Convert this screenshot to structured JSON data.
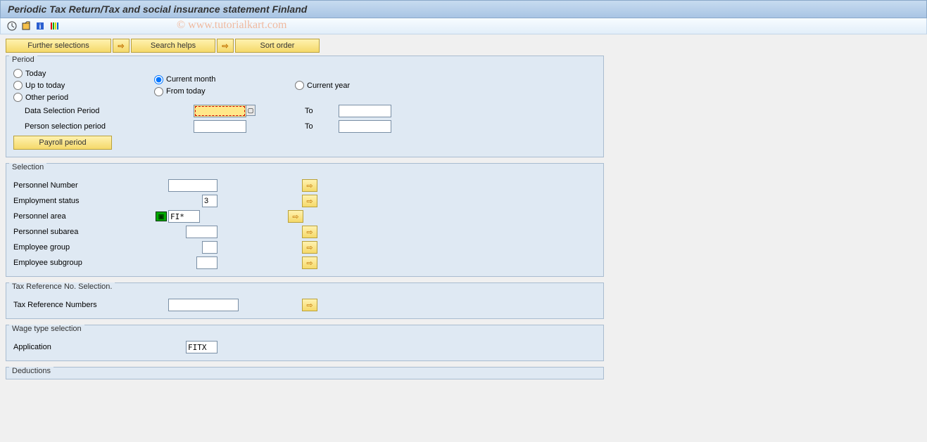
{
  "title": "Periodic Tax Return/Tax and social insurance statement Finland",
  "watermark": "© www.tutorialkart.com",
  "buttons": {
    "further_selections": "Further selections",
    "search_helps": "Search helps",
    "sort_order": "Sort order",
    "payroll_period": "Payroll period"
  },
  "period": {
    "title": "Period",
    "today": "Today",
    "current_month": "Current month",
    "current_year": "Current year",
    "up_to_today": "Up to today",
    "from_today": "From today",
    "other_period": "Other period",
    "data_sel_label": "Data Selection Period",
    "person_sel_label": "Person selection period",
    "to": "To"
  },
  "selection": {
    "title": "Selection",
    "pernr": "Personnel Number",
    "emp_status": "Employment status",
    "emp_status_val": "3",
    "pers_area": "Personnel area",
    "pers_area_val": "FI*",
    "pers_subarea": "Personnel subarea",
    "emp_group": "Employee group",
    "emp_subgroup": "Employee subgroup"
  },
  "taxref": {
    "title": "Tax Reference No. Selection.",
    "label": "Tax Reference Numbers"
  },
  "wagetype": {
    "title": "Wage type selection",
    "label": "Application",
    "value": "FITX"
  },
  "deductions": {
    "title": "Deductions"
  }
}
